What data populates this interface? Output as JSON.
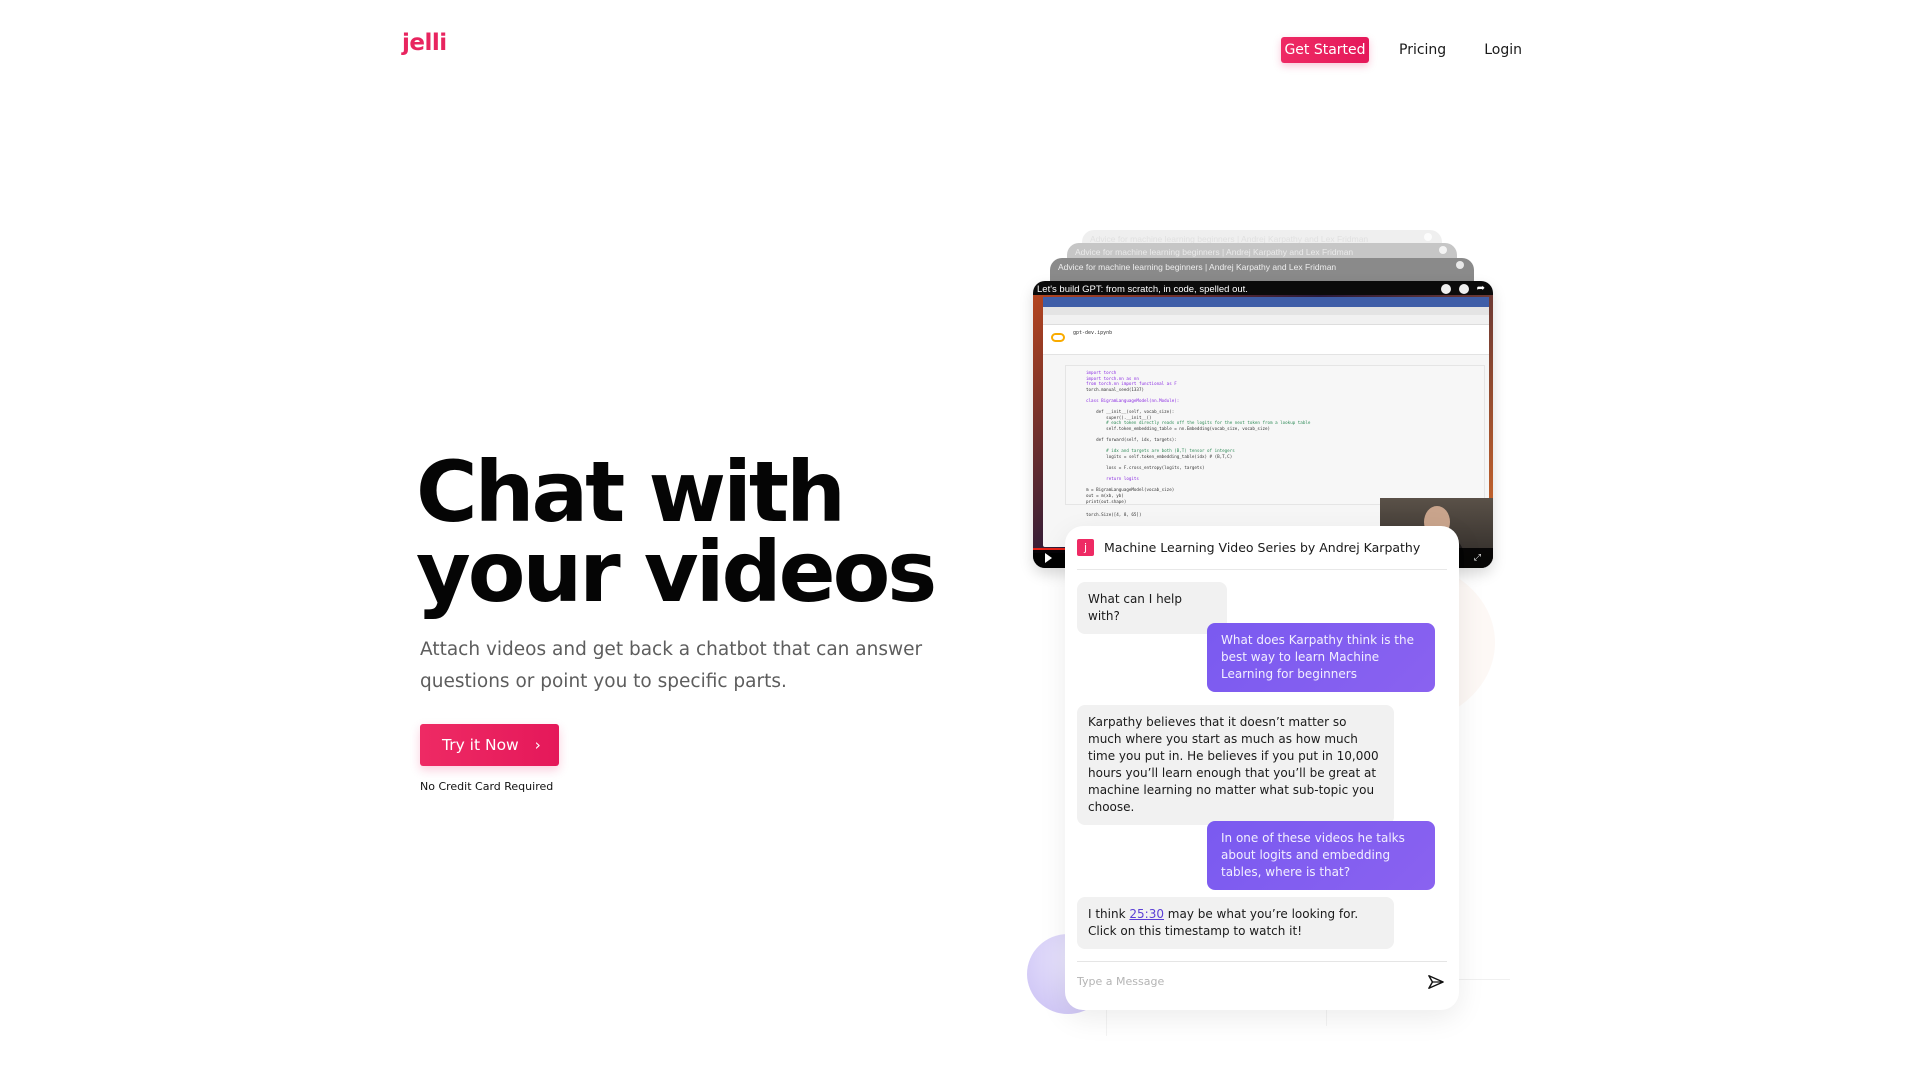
{
  "nav": {
    "logo": "jelli",
    "get_started": "Get Started",
    "pricing": "Pricing",
    "login": "Login"
  },
  "hero": {
    "title_line1": "Chat with",
    "title_line2": "your videos",
    "subtitle": "Attach videos and get back a chatbot that can answer questions or point you to specific parts.",
    "cta_label": "Try it Now",
    "cta_icon": "chevron-right-icon",
    "note": "No Credit Card Required"
  },
  "colors": {
    "brand": "#e8245f",
    "user_bubble": "#7a5af0",
    "bot_bubble": "#f1f1f1",
    "link": "#5b3fd6"
  },
  "video_stack": {
    "layers": [
      "Advice for machine learning beginners | Andrej Karpathy and Lex Fridman",
      "Advice for machine learning beginners | Andrej Karpathy and Lex Fridman",
      "Advice for machine learning beginners | Andrej Karpathy and Lex Fridman"
    ],
    "front_title": "Let's build GPT: from scratch, in code, spelled out.",
    "notebook_name": "gpt-dev.ipynb",
    "code_lines": [
      {
        "t": "import torch",
        "c": "kw"
      },
      {
        "t": "import torch.nn as nn",
        "c": "kw"
      },
      {
        "t": "from torch.nn import functional as F",
        "c": "kw"
      },
      {
        "t": "torch.manual_seed(1337)",
        "c": ""
      },
      {
        "t": "",
        "c": ""
      },
      {
        "t": "class BigramLanguageModel(nn.Module):",
        "c": "kw"
      },
      {
        "t": "",
        "c": ""
      },
      {
        "t": "    def __init__(self, vocab_size):",
        "c": ""
      },
      {
        "t": "        super().__init__()",
        "c": ""
      },
      {
        "t": "        # each token directly reads off the logits for the next token from a lookup table",
        "c": "cm"
      },
      {
        "t": "        self.token_embedding_table = nn.Embedding(vocab_size, vocab_size)",
        "c": ""
      },
      {
        "t": "",
        "c": ""
      },
      {
        "t": "    def forward(self, idx, targets):",
        "c": ""
      },
      {
        "t": "",
        "c": ""
      },
      {
        "t": "        # idx and targets are both (B,T) tensor of integers",
        "c": "cm"
      },
      {
        "t": "        logits = self.token_embedding_table(idx) # (B,T,C)",
        "c": ""
      },
      {
        "t": "",
        "c": ""
      },
      {
        "t": "        loss = F.cross_entropy(logits, targets)",
        "c": ""
      },
      {
        "t": "",
        "c": ""
      },
      {
        "t": "        return logits",
        "c": "kw"
      },
      {
        "t": "",
        "c": ""
      },
      {
        "t": "m = BigramLanguageModel(vocab_size)",
        "c": ""
      },
      {
        "t": "out = m(xb, yb)",
        "c": ""
      },
      {
        "t": "print(out.shape)",
        "c": ""
      }
    ],
    "output_line": "torch.Size([4, 8, 65])"
  },
  "chat": {
    "logo_letter": "j",
    "title": "Machine Learning Video Series by Andrej Karpathy",
    "messages": [
      {
        "role": "bot",
        "text": "What can I help with?"
      },
      {
        "role": "user",
        "text": "What does Karpathy think is the best way to learn Machine Learning for beginners"
      },
      {
        "role": "bot",
        "text": "Karpathy believes that it doesn’t matter so much where you start as much as how much time you put in. He believes if you put in 10,000 hours you’ll learn enough that you’ll be great at machine learning no matter what sub-topic you choose."
      },
      {
        "role": "user",
        "text": "In one of these videos he talks about logits and embedding tables, where is that?"
      },
      {
        "role": "bot",
        "text_before": "I think ",
        "timestamp": "25:30",
        "text_after": " may be what you’re looking for. Click on this timestamp to watch it!"
      }
    ],
    "input_placeholder": "Type a Message",
    "input_value": "",
    "send_icon": "send-icon"
  }
}
